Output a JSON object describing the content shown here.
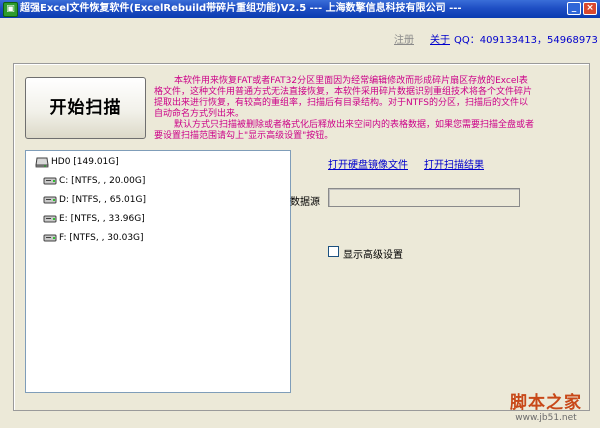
{
  "window": {
    "title": "超强Excel文件恢复软件(ExcelRebuild带碎片重组功能)V2.5 --- 上海数擎信息科技有限公司 ---",
    "min_glyph": "_",
    "close_glyph": "×"
  },
  "header": {
    "register_label": "注册",
    "about_label": "关于",
    "qq_text": "QQ：409133413，54968973"
  },
  "scan_button": {
    "label": "开始扫描"
  },
  "description": {
    "paragraph1": "本软件用来恢复FAT或者FAT32分区里面因为经常编辑修改而形成碎片扇区存放的Excel表格文件，这种文件用普通方式无法直接恢复，本软件采用碎片数据识别重组技术将各个文件碎片提取出来进行恢复，有较高的重组率，扫描后有目录结构。对于NTFS的分区，扫描后的文件以自动命名方式列出来。",
    "paragraph2": "默认方式只扫描被删除或者格式化后释放出来空间内的表格数据，如果您需要扫描全盘或者要设置扫描范围请勾上\"显示高级设置\"按钮。"
  },
  "tree": {
    "items": [
      {
        "label": "HD0 [149.01G]",
        "icon": "hard-disk-icon"
      },
      {
        "label": "C: [NTFS, , 20.00G]",
        "icon": "drive-icon"
      },
      {
        "label": "D: [NTFS, , 65.01G]",
        "icon": "drive-icon"
      },
      {
        "label": "E: [NTFS, , 33.96G]",
        "icon": "drive-icon"
      },
      {
        "label": "F: [NTFS, , 30.03G]",
        "icon": "drive-icon"
      }
    ]
  },
  "actions": {
    "open_image_label": "打开硬盘镜像文件",
    "open_result_label": "打开扫描结果"
  },
  "data_source": {
    "label": "数据源",
    "value": ""
  },
  "advanced": {
    "label": "显示高级设置",
    "checked": false
  },
  "watermark": {
    "title": "脚本之家",
    "url": "www.jb51.net"
  }
}
